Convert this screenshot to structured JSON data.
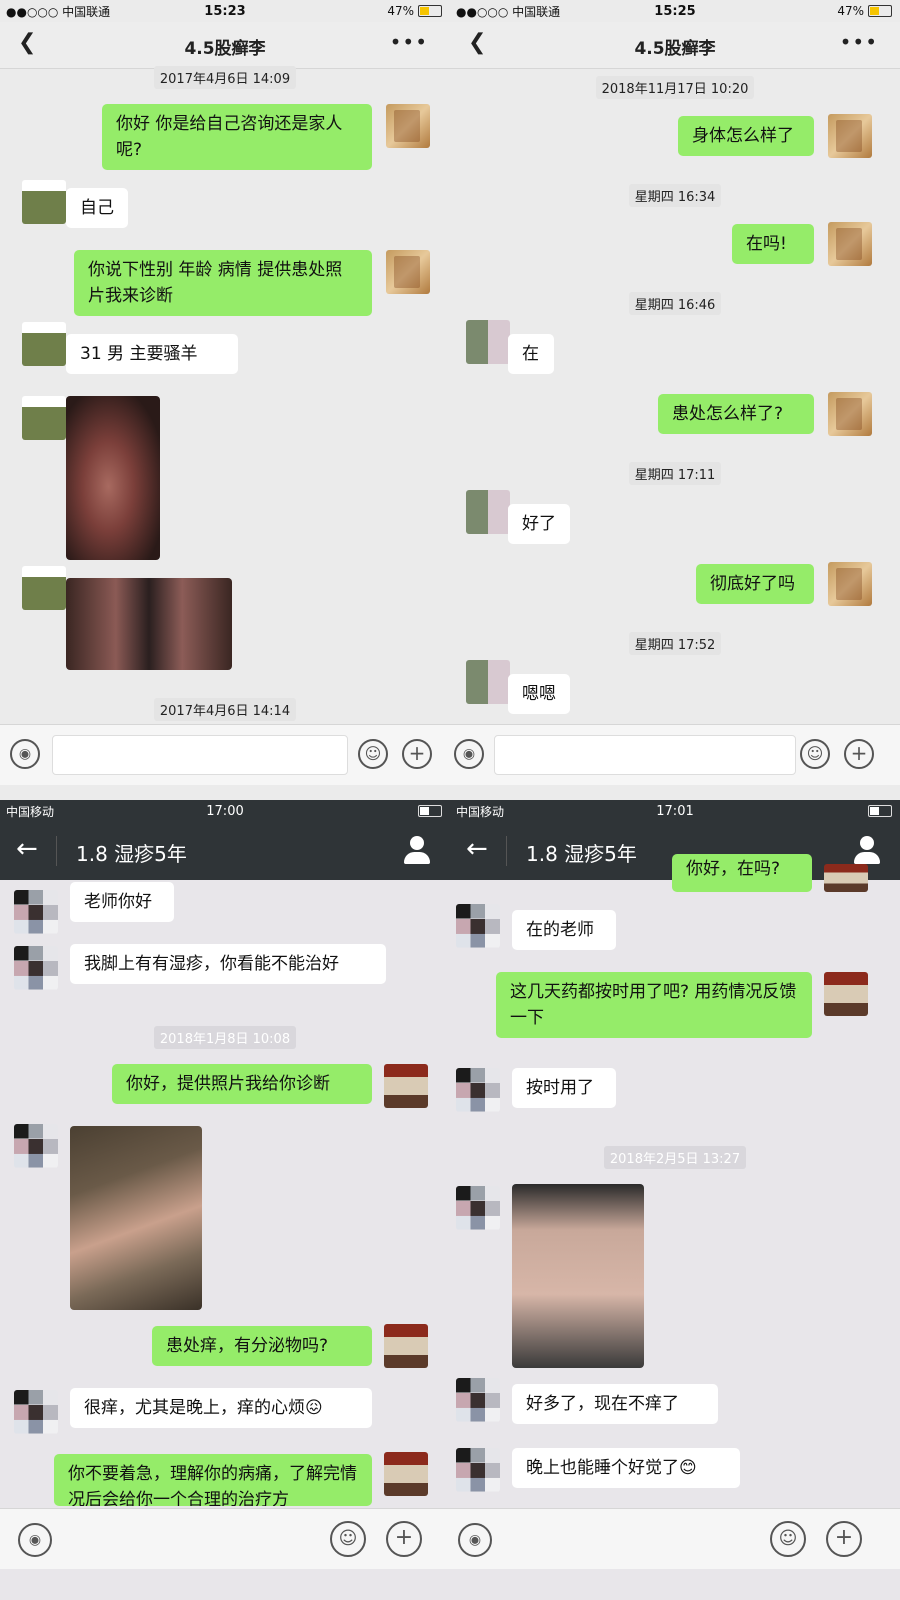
{
  "p1": {
    "status": {
      "carrier": "●●○○○ 中国联通",
      "time": "15:23",
      "battery": "47%"
    },
    "title": "4.5股癣李",
    "ts1": "2017年4月6日 14:09",
    "m1": "你好 你是给自己咨询还是家人呢?",
    "m2": "自己",
    "m3": "你说下性别 年龄 病情 提供患处照片我来诊断",
    "m4": "31  男   主要骚羊",
    "ts2": "2017年4月6日 14:14"
  },
  "p2": {
    "status": {
      "carrier": "●●○○○ 中国联通",
      "time": "15:25",
      "battery": "47%"
    },
    "title": "4.5股癣李",
    "ts1": "2018年11月17日 10:20",
    "m1": "身体怎么样了",
    "ts2": "星期四 16:34",
    "m2": "在吗!",
    "ts3": "星期四 16:46",
    "m3": "在",
    "m4": "患处怎么样了?",
    "ts4": "星期四 17:11",
    "m5": "好了",
    "m6": "彻底好了吗",
    "ts5": "星期四 17:52",
    "m7": "嗯嗯"
  },
  "p3": {
    "status": {
      "carrier": "中国移动",
      "time": "17:00"
    },
    "title": "1.8 湿疹5年",
    "m1": "老师你好",
    "m2": "我脚上有有湿疹，你看能不能治好",
    "ts1": "2018年1月8日 10:08",
    "m3": "你好，提供照片我给你诊断",
    "m4": "患处痒，有分泌物吗?",
    "m5": "很痒，尤其是晚上，痒的心烦😖",
    "m6": "你不要着急，理解你的病痛，了解完情况后会给你一个合理的治疗方"
  },
  "p4": {
    "status": {
      "carrier": "中国移动",
      "time": "17:01"
    },
    "title": "1.8 湿疹5年",
    "m0": "你好，在吗?",
    "m1": "在的老师",
    "m2": "这几天药都按时用了吧? 用药情况反馈一下",
    "m3": "按时用了",
    "ts1": "2018年2月5日 13:27",
    "m4": "好多了，现在不痒了",
    "m5": "晚上也能睡个好觉了😊"
  }
}
